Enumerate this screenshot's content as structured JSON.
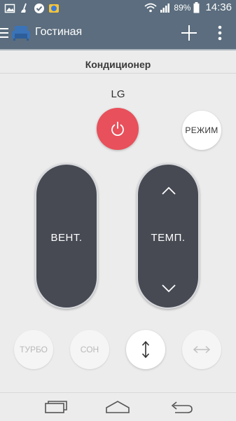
{
  "status_bar": {
    "battery_percent": "89%",
    "time": "14:36",
    "icons": [
      "image-icon",
      "broom-icon",
      "check-shield-icon",
      "app-badge-icon",
      "wifi-icon",
      "signal-icon",
      "battery-icon"
    ]
  },
  "app_bar": {
    "title": "Гостиная",
    "icons": [
      "menu-icon",
      "sofa-icon",
      "add-icon",
      "more-icon"
    ]
  },
  "device": {
    "name": "Кондиционер",
    "brand": "LG"
  },
  "controls": {
    "power_icon": "power-icon",
    "mode_label": "РЕЖИМ",
    "fan_label": "ВЕНТ.",
    "temp_label": "ТЕМП.",
    "turbo_label": "ТУРБО",
    "sleep_label": "СОН",
    "swing_vertical_icon": "vertical-arrows-icon",
    "swing_horizontal_icon": "horizontal-arrows-icon"
  },
  "nav": {
    "icons": [
      "recent-apps-icon",
      "home-icon",
      "back-icon"
    ]
  },
  "colors": {
    "app_bar": "#5b6d7e",
    "power": "#e8505b",
    "pill": "#474a53",
    "panel": "#ececec"
  }
}
